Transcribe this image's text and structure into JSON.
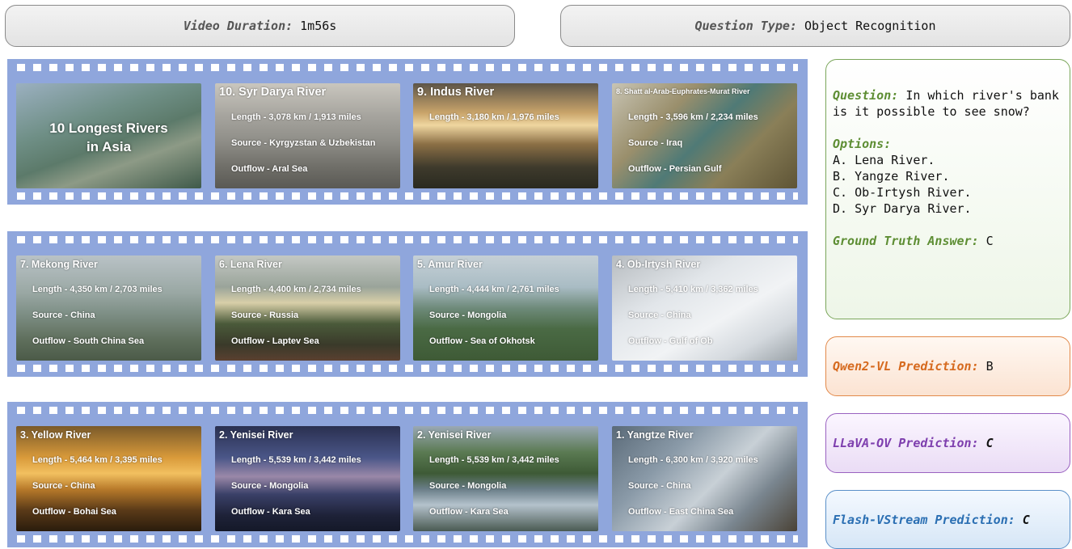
{
  "header": {
    "duration_label": "Video Duration:",
    "duration_value": "1m56s",
    "qtype_label": "Question Type:",
    "qtype_value": "Object Recognition"
  },
  "frames": {
    "f1": {
      "title": "10 Longest Rivers\nin Asia"
    },
    "f2": {
      "title": "10. Syr Darya River",
      "length": "Length - 3,078 km / 1,913 miles",
      "source": "Source - Kyrgyzstan & Uzbekistan",
      "outflow": "Outflow - Aral Sea"
    },
    "f3": {
      "title": "9. Indus River",
      "length": "Length - 3,180 km / 1,976 miles"
    },
    "f4": {
      "title": "8. Shatt al-Arab-Euphrates-Murat River",
      "length": "Length - 3,596 km / 2,234 miles",
      "source": "Source - Iraq",
      "outflow": "Outflow - Persian Gulf"
    },
    "f5": {
      "title": "7. Mekong River",
      "length": "Length - 4,350 km / 2,703 miles",
      "source": "Source - China",
      "outflow": "Outflow - South China Sea"
    },
    "f6": {
      "title": "6. Lena River",
      "length": "Length - 4,400 km / 2,734 miles",
      "source": "Source - Russia",
      "outflow": "Outflow - Laptev Sea"
    },
    "f7": {
      "title": "5. Amur River",
      "length": "Length - 4,444 km / 2,761 miles",
      "source": "Source - Mongolia",
      "outflow": "Outflow - Sea of Okhotsk"
    },
    "f8": {
      "title": "4. Ob-Irtysh River",
      "length": "Length - 5,410 km / 3,362 miles",
      "source": "Source - China",
      "outflow": "Outflow - Gulf of Ob"
    },
    "f9": {
      "title": "3. Yellow River",
      "length": "Length - 5,464 km / 3,395 miles",
      "source": "Source - China",
      "outflow": "Outflow - Bohai Sea"
    },
    "f10": {
      "title": "2. Yenisei River",
      "length": "Length - 5,539 km / 3,442 miles",
      "source": "Source - Mongolia",
      "outflow": "Outflow - Kara Sea"
    },
    "f11": {
      "title": "2. Yenisei River",
      "length": "Length - 5,539 km / 3,442 miles",
      "source": "Source - Mongolia",
      "outflow": "Outflow - Kara Sea"
    },
    "f12": {
      "title": "1. Yangtze River",
      "length": "Length - 6,300 km / 3,920 miles",
      "source": "Source - China",
      "outflow": "Outflow - East China Sea"
    }
  },
  "question": {
    "label": "Question:",
    "text": "In which river's bank is it possible to see snow?",
    "options_label": "Options:",
    "options": [
      "A. Lena River.",
      "B. Yangze River.",
      "C. Ob-Irtysh River.",
      "D. Syr Darya River."
    ],
    "answer_label": "Ground Truth Answer:",
    "answer_value": "C"
  },
  "predictions": {
    "qwen": {
      "label": "Qwen2-VL Prediction:",
      "value": "B"
    },
    "llava": {
      "label": "LLaVA-OV Prediction:",
      "value": "C"
    },
    "flash": {
      "label": "Flash-VStream Prediction:",
      "value": "C"
    }
  }
}
